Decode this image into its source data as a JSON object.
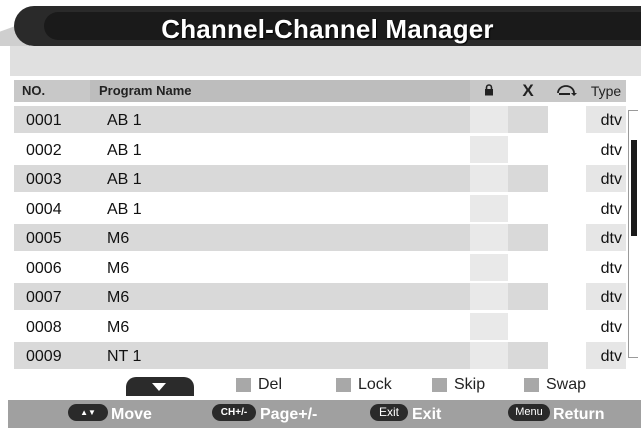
{
  "title": "Channel-Channel Manager",
  "header": {
    "no": "NO.",
    "program_name": "Program Name",
    "lock_icon": "lock-icon",
    "del": "X",
    "skip_icon": "skip-icon",
    "type": "Type"
  },
  "channels": [
    {
      "no": "0001",
      "name": "AB 1",
      "type": "dtv"
    },
    {
      "no": "0002",
      "name": "AB 1",
      "type": "dtv"
    },
    {
      "no": "0003",
      "name": "AB 1",
      "type": "dtv"
    },
    {
      "no": "0004",
      "name": "AB 1",
      "type": "dtv"
    },
    {
      "no": "0005",
      "name": "M6",
      "type": "dtv"
    },
    {
      "no": "0006",
      "name": "M6",
      "type": "dtv"
    },
    {
      "no": "0007",
      "name": "M6",
      "type": "dtv"
    },
    {
      "no": "0008",
      "name": "M6",
      "type": "dtv"
    },
    {
      "no": "0009",
      "name": "NT 1",
      "type": "dtv"
    }
  ],
  "legend": {
    "page_down_icon": "triangle-down-icon",
    "del": "Del",
    "lock": "Lock",
    "skip": "Skip",
    "swap": "Swap"
  },
  "footer": {
    "move_key": "▲▼",
    "move": "Move",
    "page_key": "CH+/-",
    "page": "Page+/-",
    "exit_key": "Exit",
    "exit": "Exit",
    "menu_key": "Menu",
    "return": "Return"
  },
  "scroll_position": 0.18,
  "colors": {
    "title_bg": "#1a1a1a",
    "row_shade": "#d9d9d9",
    "footer_bg": "#a0a0a0",
    "swatch": "#a8a8a8"
  }
}
